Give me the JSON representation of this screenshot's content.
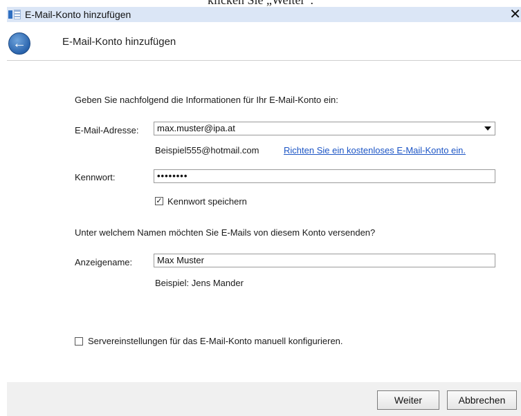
{
  "caption": "klicken Sie „Weiter“.",
  "window": {
    "title": "E-Mail-Konto hinzufügen",
    "close_glyph": "✕"
  },
  "header": {
    "title": "E-Mail-Konto hinzufügen",
    "back_icon": "back-arrow-icon"
  },
  "form": {
    "intro": "Geben Sie nachfolgend die Informationen für Ihr E-Mail-Konto ein:",
    "email_label": "E-Mail-Adresse:",
    "email_value": "max.muster@ipa.at",
    "email_example": "Beispiel555@hotmail.com",
    "free_account_link": "Richten Sie ein kostenloses E-Mail-Konto ein.",
    "password_label": "Kennwort:",
    "password_value": "••••••••",
    "save_password_label": "Kennwort speichern",
    "save_password_checked": true,
    "sender_question": "Unter welchem Namen möchten Sie E-Mails von diesem Konto versenden?",
    "display_name_label": "Anzeigename:",
    "display_name_value": "Max Muster",
    "display_name_example": "Beispiel: Jens Mander",
    "manual_config_label": "Servereinstellungen für das E-Mail-Konto manuell konfigurieren.",
    "manual_config_checked": false
  },
  "footer": {
    "next_label": "Weiter",
    "cancel_label": "Abbrechen"
  },
  "colors": {
    "titlebar": "#dbe6f6",
    "link": "#1c55c5",
    "footer": "#f0f0f0"
  }
}
